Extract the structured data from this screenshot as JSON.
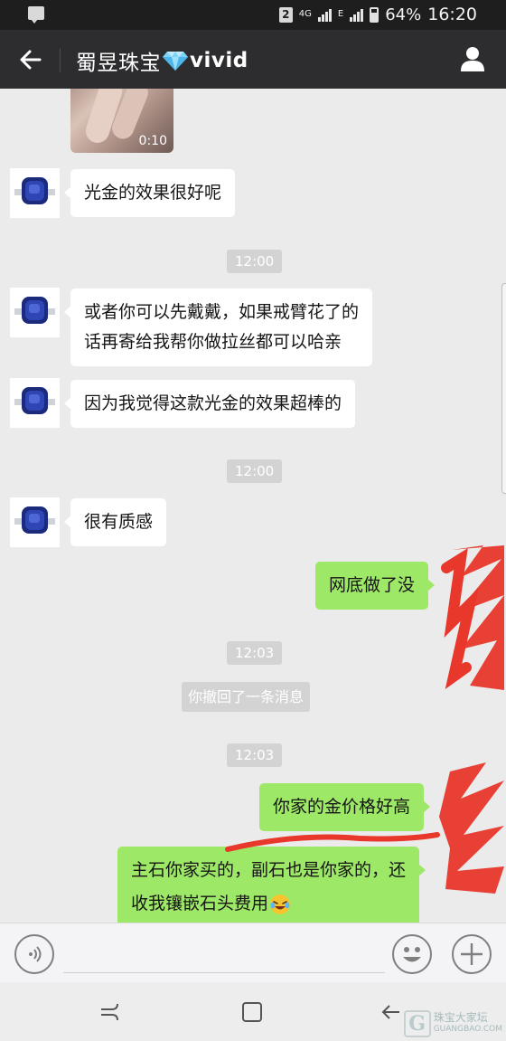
{
  "status_bar": {
    "sim": "2",
    "network": "4G",
    "network2": "E",
    "battery": "64%",
    "time": "16:20"
  },
  "header": {
    "title_prefix": "蜀昱珠宝",
    "title_suffix": "vivid"
  },
  "video": {
    "duration": "0:10"
  },
  "messages": {
    "m1": "光金的效果很好呢",
    "t1": "12:00",
    "m2_line1": "或者你可以先戴戴，如果戒臂花了的",
    "m2_line2": "话再寄给我帮你做拉丝都可以哈亲",
    "m3": "因为我觉得这款光金的效果超棒的",
    "t2": "12:00",
    "m4": "很有质感",
    "m5": "网底做了没",
    "t3": "12:03",
    "sys": "你撤回了一条消息",
    "t4": "12:03",
    "m6": "你家的金价格好高",
    "m7_line1": "主石你家买的，副石也是你家的，还",
    "m7_line2": "收我镶嵌石头费用"
  },
  "watermark": {
    "logo": "G",
    "text1": "珠宝大家坛",
    "text2": "GUANGBAO.COM"
  },
  "icons": [
    "back-arrow-icon",
    "diamond-icon",
    "person-icon",
    "voice-icon",
    "emoji-icon",
    "plus-icon",
    "recent-apps-icon",
    "home-icon",
    "back-icon"
  ],
  "colors": {
    "outgoing_bubble": "#9ee867",
    "header_bg": "#2d2d2f",
    "chat_bg": "#ebebeb"
  }
}
